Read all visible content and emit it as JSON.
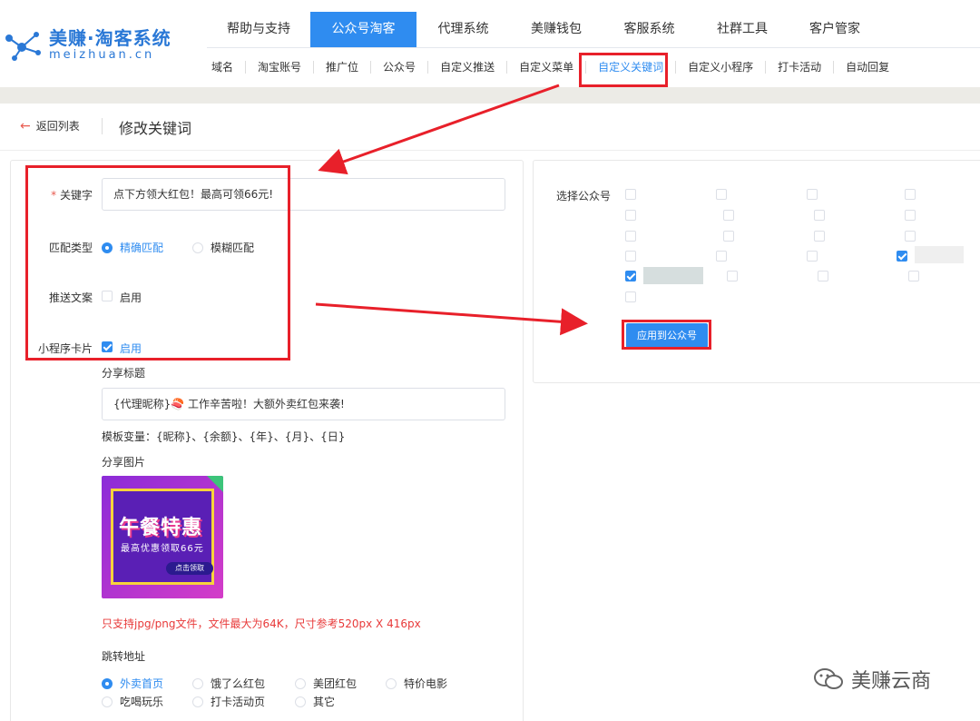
{
  "logo": {
    "title": "美赚·淘客系统",
    "subtitle": "meizhuan.cn"
  },
  "main_nav": [
    "帮助与支持",
    "公众号淘客",
    "代理系统",
    "美赚钱包",
    "客服系统",
    "社群工具",
    "客户管家"
  ],
  "sub_nav": [
    "域名",
    "淘宝账号",
    "推广位",
    "公众号",
    "自定义推送",
    "自定义菜单",
    "自定义关键词",
    "自定义小程序",
    "打卡活动",
    "自动回复"
  ],
  "crumb": {
    "back": "返回列表",
    "title": "修改关键词"
  },
  "form": {
    "keyword_label": "关键字",
    "keyword_required": "*",
    "keyword_value": "点下方领大红包！最高可领66元!",
    "match_label": "匹配类型",
    "match_exact": "精确匹配",
    "match_fuzzy": "模糊匹配",
    "push_label": "推送文案",
    "push_enable": "启用",
    "mini_label": "小程序卡片",
    "mini_enable": "启用",
    "share_title_label": "分享标题",
    "share_title_value": "{代理昵称}🍣 工作辛苦啦！大额外卖红包来袭!",
    "template_vars": "模板变量：{昵称}、{余额}、{年}、{月}、{日}",
    "share_image_label": "分享图片",
    "image_hint": "只支持jpg/png文件，文件最大为64K，尺寸参考520px X 416px",
    "jump_label": "跳转地址",
    "jump_options": [
      "外卖首页",
      "饿了么红包",
      "美团红包",
      "特价电影",
      "吃喝玩乐",
      "打卡活动页",
      "其它"
    ]
  },
  "share_image": {
    "big_text": "午餐特惠",
    "small_text": "最高优惠领取66元",
    "button_text": "点击领取"
  },
  "right": {
    "select_label": "选择公众号",
    "apply_button": "应用到公众号"
  },
  "watermark": "美赚云商",
  "colors": {
    "primary": "#2f8cf0",
    "annotation": "#e8202a",
    "hint": "#e83a3a"
  }
}
